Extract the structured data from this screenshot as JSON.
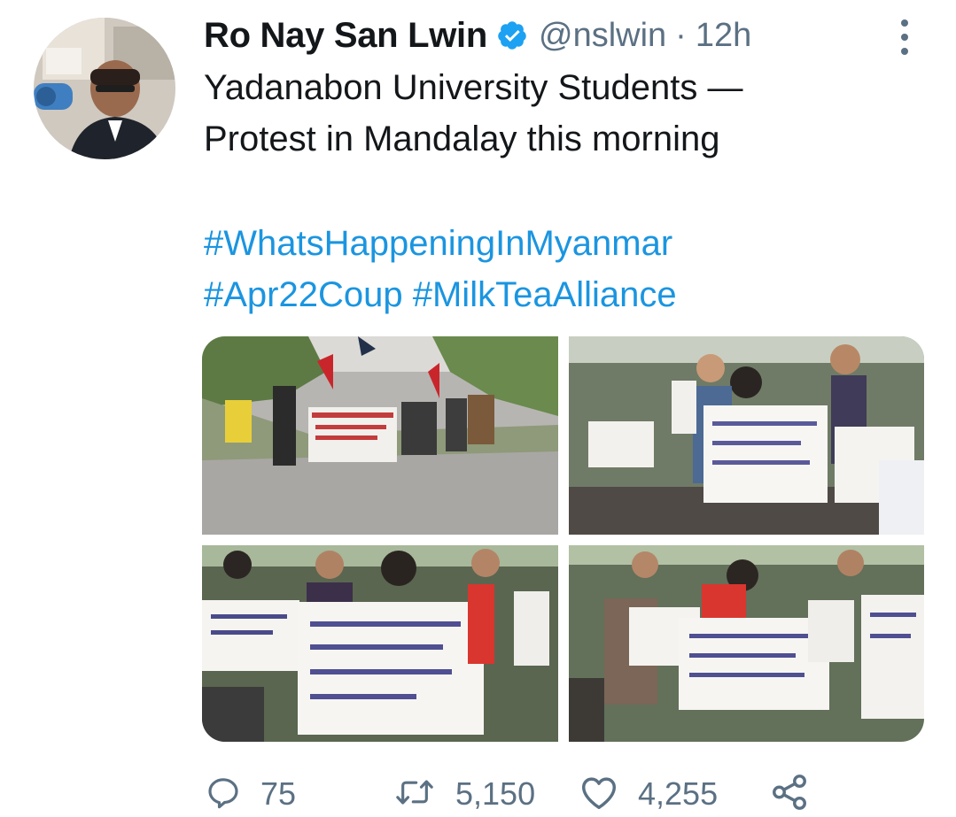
{
  "tweet": {
    "display_name": "Ro Nay San Lwin",
    "verified": true,
    "handle": "@nslwin",
    "separator": "·",
    "time": "12h",
    "text_lines": [
      "Yadanabon University Students —",
      "Protest in Mandalay this morning"
    ],
    "hashtags": [
      "#WhatsHappeningInMyanmar",
      "#Apr22Coup",
      "#MilkTeaAlliance"
    ],
    "media": [
      {
        "name": "protest-march-photo"
      },
      {
        "name": "protest-signs-photo-1"
      },
      {
        "name": "protest-signs-photo-2"
      },
      {
        "name": "protest-signs-photo-3"
      }
    ]
  },
  "actions": {
    "reply_count": "75",
    "retweet_count": "5,150",
    "like_count": "4,255"
  },
  "icons": {
    "reply": "reply-icon",
    "retweet": "retweet-icon",
    "like": "like-icon",
    "share": "share-icon",
    "more": "more-options-icon",
    "verified": "verified-badge-icon"
  },
  "colors": {
    "link": "#1b95e0",
    "secondary_text": "#5b7083",
    "primary_text": "#14171a",
    "verified": "#1da1f2"
  }
}
